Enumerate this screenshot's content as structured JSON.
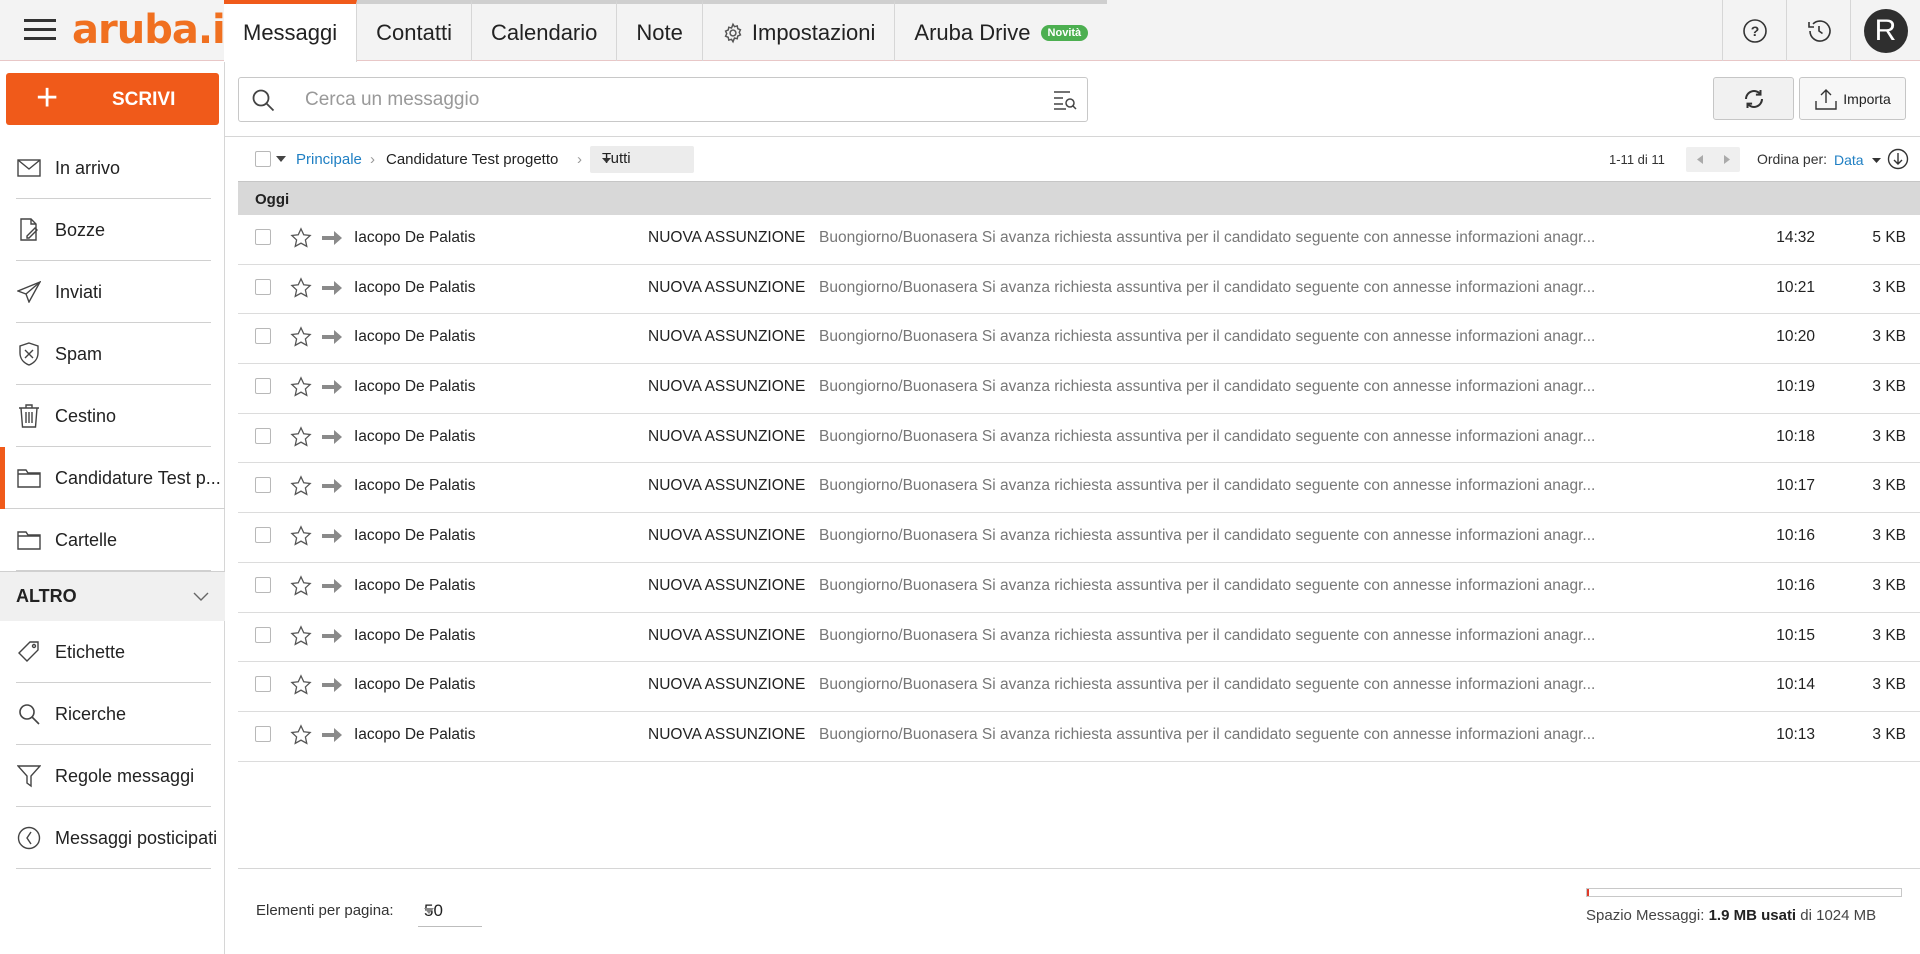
{
  "app": {
    "logo": "aruba.it",
    "accent_color": "#f05a1a",
    "link_color": "#1f7fc3"
  },
  "tabs": [
    {
      "label": "Messaggi",
      "active": true
    },
    {
      "label": "Contatti"
    },
    {
      "label": "Calendario"
    },
    {
      "label": "Note"
    },
    {
      "label": "Impostazioni",
      "icon": "gear-icon"
    },
    {
      "label": "Aruba Drive",
      "badge": "Novità"
    }
  ],
  "topbar": {
    "help_icon": "help-icon",
    "history_icon": "clock-icon",
    "avatar_initial": "R"
  },
  "compose": {
    "label": "SCRIVI"
  },
  "sidebar": {
    "folders": [
      {
        "label": "In arrivo",
        "icon": "inbox-icon"
      },
      {
        "label": "Bozze",
        "icon": "drafts-icon"
      },
      {
        "label": "Inviati",
        "icon": "sent-icon"
      },
      {
        "label": "Spam",
        "icon": "spam-icon"
      },
      {
        "label": "Cestino",
        "icon": "trash-icon"
      },
      {
        "label": "Candidature Test p...",
        "icon": "folder-icon",
        "selected": true
      },
      {
        "label": "Cartelle",
        "icon": "folder-icon"
      }
    ],
    "altro_label": "ALTRO",
    "extra": [
      {
        "label": "Etichette",
        "icon": "tag-icon"
      },
      {
        "label": "Ricerche",
        "icon": "search-icon"
      },
      {
        "label": "Regole messaggi",
        "icon": "filter-icon"
      },
      {
        "label": "Messaggi posticipati",
        "icon": "clock-icon"
      }
    ]
  },
  "search": {
    "placeholder": "Cerca un messaggio"
  },
  "toolbar": {
    "import_label": "Importa"
  },
  "breadcrumb": {
    "home": "Principale",
    "folder": "Candidature Test progetto",
    "filter": "Tutti"
  },
  "pager": {
    "range": "1-11 di 11"
  },
  "sort": {
    "label": "Ordina per:",
    "value": "Data"
  },
  "list": {
    "group": "Oggi",
    "rows": [
      {
        "from": "Iacopo De Palatis",
        "subject": "NUOVA ASSUNZIONE",
        "preview": "Buongiorno/Buonasera Si avanza richiesta assuntiva per il candidato seguente con annesse informazioni anagr...",
        "time": "14:32",
        "size": "5 KB"
      },
      {
        "from": "Iacopo De Palatis",
        "subject": "NUOVA ASSUNZIONE",
        "preview": "Buongiorno/Buonasera Si avanza richiesta assuntiva per il candidato seguente con annesse informazioni anagr...",
        "time": "10:21",
        "size": "3 KB"
      },
      {
        "from": "Iacopo De Palatis",
        "subject": "NUOVA ASSUNZIONE",
        "preview": "Buongiorno/Buonasera Si avanza richiesta assuntiva per il candidato seguente con annesse informazioni anagr...",
        "time": "10:20",
        "size": "3 KB"
      },
      {
        "from": "Iacopo De Palatis",
        "subject": "NUOVA ASSUNZIONE",
        "preview": "Buongiorno/Buonasera Si avanza richiesta assuntiva per il candidato seguente con annesse informazioni anagr...",
        "time": "10:19",
        "size": "3 KB"
      },
      {
        "from": "Iacopo De Palatis",
        "subject": "NUOVA ASSUNZIONE",
        "preview": "Buongiorno/Buonasera Si avanza richiesta assuntiva per il candidato seguente con annesse informazioni anagr...",
        "time": "10:18",
        "size": "3 KB"
      },
      {
        "from": "Iacopo De Palatis",
        "subject": "NUOVA ASSUNZIONE",
        "preview": "Buongiorno/Buonasera Si avanza richiesta assuntiva per il candidato seguente con annesse informazioni anagr...",
        "time": "10:17",
        "size": "3 KB"
      },
      {
        "from": "Iacopo De Palatis",
        "subject": "NUOVA ASSUNZIONE",
        "preview": "Buongiorno/Buonasera Si avanza richiesta assuntiva per il candidato seguente con annesse informazioni anagr...",
        "time": "10:16",
        "size": "3 KB"
      },
      {
        "from": "Iacopo De Palatis",
        "subject": "NUOVA ASSUNZIONE",
        "preview": "Buongiorno/Buonasera Si avanza richiesta assuntiva per il candidato seguente con annesse informazioni anagr...",
        "time": "10:16",
        "size": "3 KB"
      },
      {
        "from": "Iacopo De Palatis",
        "subject": "NUOVA ASSUNZIONE",
        "preview": "Buongiorno/Buonasera Si avanza richiesta assuntiva per il candidato seguente con annesse informazioni anagr...",
        "time": "10:15",
        "size": "3 KB"
      },
      {
        "from": "Iacopo De Palatis",
        "subject": "NUOVA ASSUNZIONE",
        "preview": "Buongiorno/Buonasera Si avanza richiesta assuntiva per il candidato seguente con annesse informazioni anagr...",
        "time": "10:14",
        "size": "3 KB"
      },
      {
        "from": "Iacopo De Palatis",
        "subject": "NUOVA ASSUNZIONE",
        "preview": "Buongiorno/Buonasera Si avanza richiesta assuntiva per il candidato seguente con annesse informazioni anagr...",
        "time": "10:13",
        "size": "3 KB"
      }
    ]
  },
  "footer": {
    "per_page_label": "Elementi per pagina:",
    "per_page_value": "50",
    "quota_prefix": "Spazio Messaggi:",
    "quota_used": "1.9 MB usati",
    "quota_suffix": "di 1024 MB",
    "quota_fraction": 0.0019
  }
}
